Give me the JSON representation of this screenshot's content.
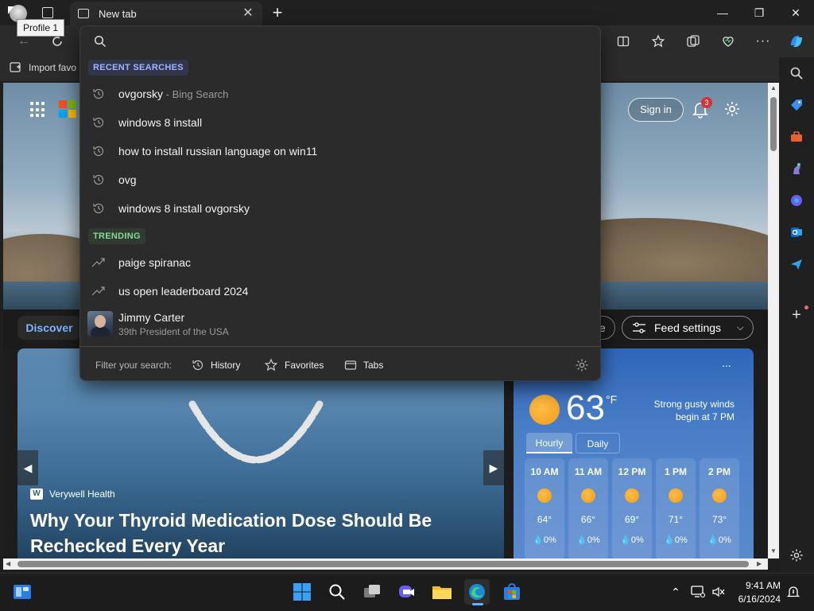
{
  "tab": {
    "title": "New tab",
    "close": "✕",
    "new_tab": "+"
  },
  "window": {
    "minimize": "—",
    "maximize": "❐",
    "close": "✕"
  },
  "tooltip": "Profile 1",
  "favorites_bar": {
    "import_label": "Import favo"
  },
  "address": {
    "value": "",
    "placeholder": ""
  },
  "dropdown": {
    "recent_header": "RECENT SEARCHES",
    "recent": [
      {
        "text": "ovgorsky",
        "sub": " - Bing Search"
      },
      {
        "text": "windows 8 install",
        "sub": ""
      },
      {
        "text": "how to install russian language on win11",
        "sub": ""
      },
      {
        "text": "ovg",
        "sub": ""
      },
      {
        "text": "windows 8 install ovgorsky",
        "sub": ""
      }
    ],
    "trending_header": "TRENDING",
    "trending": [
      {
        "text": "paige spiranac"
      },
      {
        "text": "us open leaderboard 2024"
      }
    ],
    "entity": {
      "name": "Jimmy Carter",
      "description": "39th President of the USA"
    },
    "filter": {
      "label": "Filter your search:",
      "history": "History",
      "favorites": "Favorites",
      "tabs": "Tabs"
    }
  },
  "page": {
    "sign_in": "Sign in",
    "notifications_count": "3",
    "discover_tab": "Discover",
    "partial_button": "e",
    "feed_settings": "Feed settings",
    "news": {
      "source": "Verywell Health",
      "source_logo": "W",
      "title": "Why Your Thyroid Medication Dose Should Be Rechecked Every Year"
    },
    "weather": {
      "more": "...",
      "temperature": "63",
      "unit": "°F",
      "alert": "Strong gusty winds begin at 7 PM",
      "tab_hourly": "Hourly",
      "tab_daily": "Daily",
      "hours": [
        {
          "time": "10 AM",
          "temp": "64°",
          "rain": "💧0%"
        },
        {
          "time": "11 AM",
          "temp": "66°",
          "rain": "💧0%"
        },
        {
          "time": "12 PM",
          "temp": "69°",
          "rain": "💧0%"
        },
        {
          "time": "1 PM",
          "temp": "71°",
          "rain": "💧0%"
        },
        {
          "time": "2 PM",
          "temp": "73°",
          "rain": "💧0%"
        }
      ]
    }
  },
  "taskbar": {
    "time": "9:41 AM",
    "date": "6/16/2024"
  },
  "colors": {
    "recent_header": "#9fb4ff",
    "recent_header_bg": "#33364a",
    "trending_header": "#8fd694",
    "trending_header_bg": "#2f3a31",
    "accent_blue": "#3b8eea"
  }
}
